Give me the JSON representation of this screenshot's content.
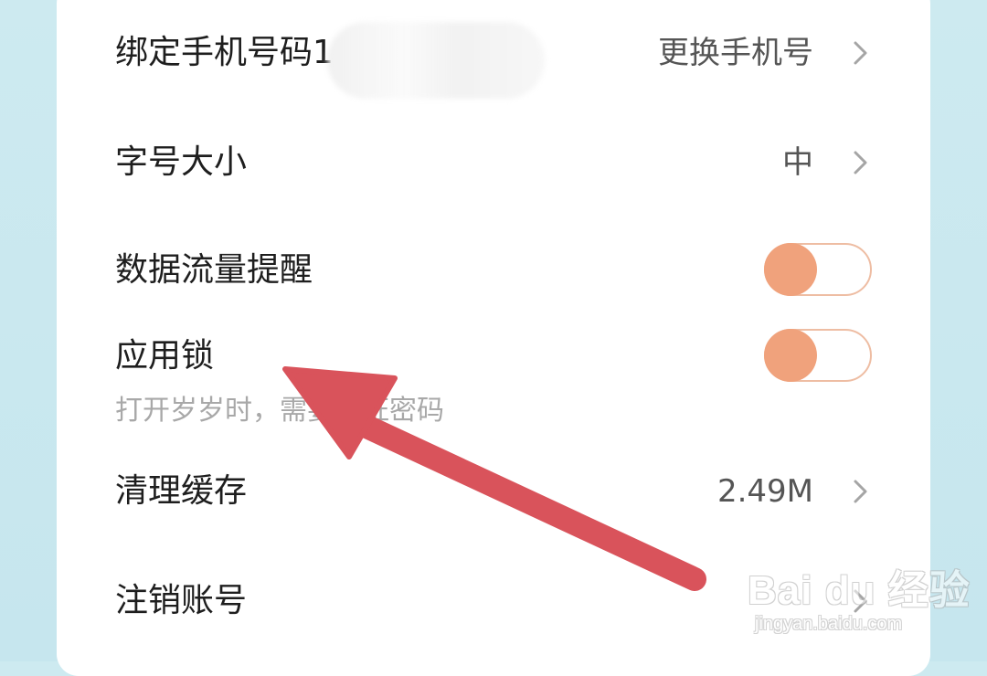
{
  "settings": {
    "bind_phone": {
      "label": "绑定手机号码1",
      "action": "更换手机号"
    },
    "font_size": {
      "label": "字号大小",
      "value": "中"
    },
    "data_usage_alert": {
      "label": "数据流量提醒",
      "enabled": true
    },
    "app_lock": {
      "label": "应用锁",
      "enabled": true,
      "description": "打开岁岁时，需要验证密码"
    },
    "clear_cache": {
      "label": "清理缓存",
      "value": "2.49M"
    },
    "delete_account": {
      "label": "注销账号"
    }
  },
  "colors": {
    "toggle_on": "#f0a27c",
    "toggle_border": "#eebda3",
    "annotation_arrow": "#d9535b",
    "background": "#cdeaf0"
  },
  "icons": {
    "chevron": "chevron-right-icon",
    "annotation": "arrow-annotation-icon"
  },
  "watermark": {
    "main": "Bai du 经验",
    "sub": "jingyan.baidu.com"
  }
}
